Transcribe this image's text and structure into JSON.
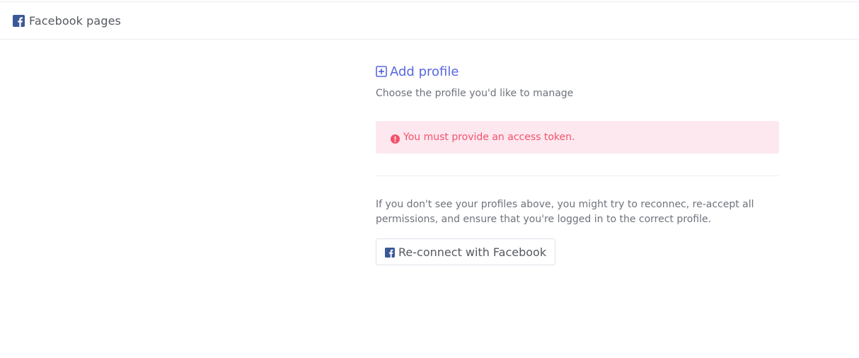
{
  "header": {
    "icon": "facebook-icon",
    "title": "Facebook pages"
  },
  "main": {
    "add_profile_icon": "plus-square-icon",
    "add_profile_label": "Add profile",
    "subtitle": "Choose the profile you'd like to manage",
    "alert": {
      "icon": "exclamation-circle-icon",
      "message": "You must provide an access token."
    },
    "help_text": "If you don't see your profiles above, you might try to reconnec, re-accept all permissions, and ensure that you're logged in to the correct profile.",
    "reconnect_button": {
      "icon": "facebook-icon",
      "label": "Re-connect with Facebook"
    }
  },
  "colors": {
    "accent": "#5867dd",
    "facebook": "#3b5998",
    "danger_text": "#f4516c",
    "danger_bg": "#fde8ef",
    "text": "#575962",
    "border": "#ebedf2"
  }
}
